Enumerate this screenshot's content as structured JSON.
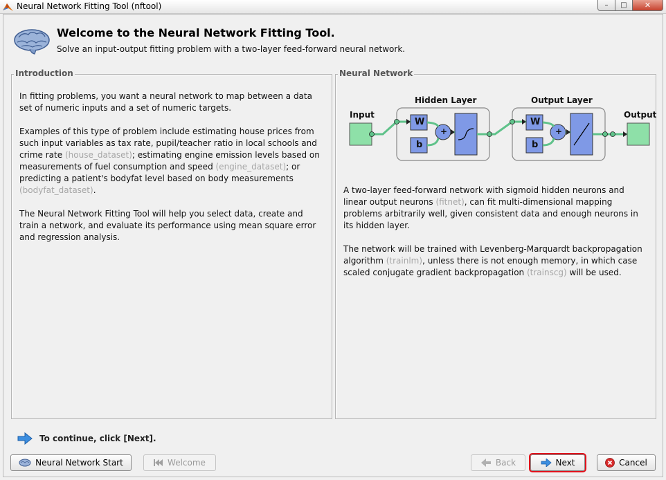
{
  "window": {
    "title": "Neural Network Fitting Tool (nftool)",
    "controls": {
      "minimize": "–",
      "maximize": "□",
      "close": "✕"
    }
  },
  "header": {
    "title": "Welcome to the Neural Network Fitting Tool.",
    "subtitle": "Solve an input-output fitting problem with a two-layer feed-forward neural network."
  },
  "intro": {
    "title": "Introduction",
    "p1": "In fitting problems, you want a neural network to map between a data set of numeric inputs and a set of numeric targets.",
    "p2": {
      "t1": "Examples of this type of problem include estimating house prices from such input variables as tax rate, pupil/teacher ratio in local schools and crime rate ",
      "l1": "(house_dataset)",
      "t2": "; estimating engine emission levels based on measurements of fuel consumption and speed ",
      "l2": "(engine_dataset)",
      "t3": "; or predicting a patient's bodyfat level based on body measurements ",
      "l3": "(bodyfat_dataset)",
      "t4": "."
    },
    "p3": "The Neural Network Fitting Tool will help you select data, create and train a network, and evaluate its performance using mean square error and regression analysis."
  },
  "network": {
    "title": "Neural Network",
    "diagram": {
      "input_label": "Input",
      "hidden_label": "Hidden Layer",
      "output_layer_label": "Output Layer",
      "output_label": "Output",
      "weight": "W",
      "bias": "b",
      "sum": "+"
    },
    "p1": {
      "t1": "A two-layer feed-forward network with sigmoid hidden neurons and linear output neurons ",
      "l1": "(fitnet)",
      "t2": ", can fit multi-dimensional mapping problems arbitrarily well, given consistent data and enough neurons in its hidden layer."
    },
    "p2": {
      "t1": "The network will be trained with Levenberg-Marquardt backpropagation algorithm ",
      "l1": "(trainlm)",
      "t2": ", unless there is not enough memory, in which case scaled conjugate gradient backpropagation ",
      "l2": "(trainscg)",
      "t3": " will be used."
    }
  },
  "footer": {
    "continue_text": "To continue, click [Next].",
    "nn_start": "Neural Network Start",
    "welcome": "Welcome",
    "back": "Back",
    "next": "Next",
    "cancel": "Cancel"
  },
  "colors": {
    "input_green": "#8ee0a8",
    "block_blue": "#7f99e6",
    "connector_green": "#5fc28a"
  }
}
